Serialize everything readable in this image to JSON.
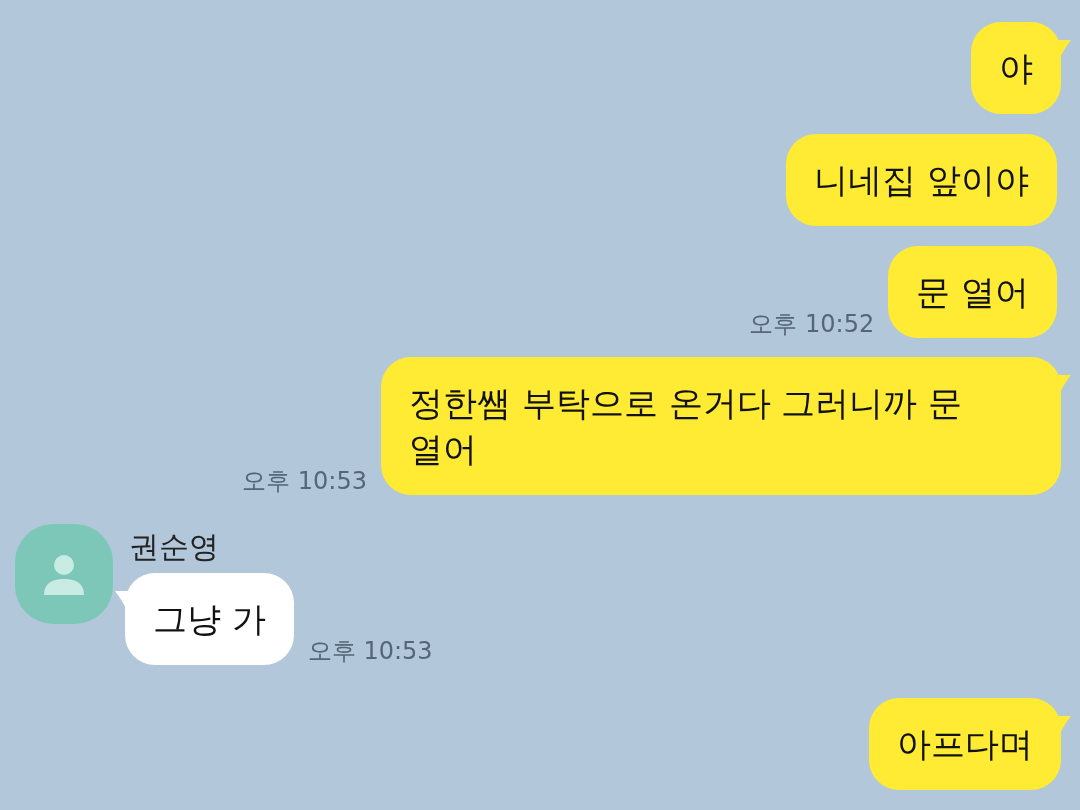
{
  "messages": [
    {
      "kind": "sent",
      "text": "야",
      "tail": true
    },
    {
      "kind": "sent",
      "text": "니네집 앞이야",
      "tail": false
    },
    {
      "kind": "sent",
      "text": "문 열어",
      "tail": false,
      "time": "오후 10:52"
    },
    {
      "kind": "sent",
      "text": "정한쌤 부탁으로 온거다 그러니까 문 열어",
      "tail": true,
      "time": "오후 10:53"
    },
    {
      "kind": "received",
      "sender": "권순영",
      "text": "그냥 가",
      "tail": true,
      "time": "오후 10:53"
    },
    {
      "kind": "sent",
      "text": "아프다며",
      "tail": true
    }
  ]
}
